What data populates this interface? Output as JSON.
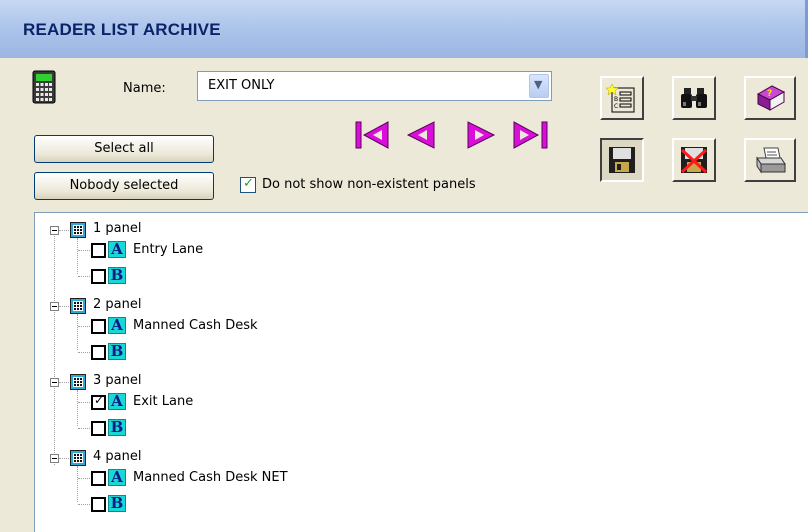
{
  "window": {
    "title": "READER LIST ARCHIVE"
  },
  "form": {
    "name_label": "Name:",
    "name_value": "EXIT ONLY",
    "select_all_label": "Select all",
    "nobody_selected_label": "Nobody selected",
    "hide_nonexistent_label": "Do not show non-existent panels",
    "hide_nonexistent_checked": true
  },
  "navigation": [
    {
      "name": "first-record-icon"
    },
    {
      "name": "previous-record-icon"
    },
    {
      "name": "next-record-icon"
    },
    {
      "name": "last-record-icon"
    }
  ],
  "toolbar": [
    {
      "name": "new-list-icon"
    },
    {
      "name": "find-binoculars-icon"
    },
    {
      "name": "help-book-icon"
    },
    {
      "name": "save-floppy-icon"
    },
    {
      "name": "delete-icon"
    },
    {
      "name": "print-icon"
    }
  ],
  "tree": [
    {
      "label": "1 panel",
      "readers": [
        {
          "letter": "A",
          "label": "Entry Lane",
          "checked": false
        },
        {
          "letter": "B",
          "label": "",
          "checked": false
        }
      ]
    },
    {
      "label": "2 panel",
      "readers": [
        {
          "letter": "A",
          "label": "Manned Cash Desk",
          "checked": false
        },
        {
          "letter": "B",
          "label": "",
          "checked": false
        }
      ]
    },
    {
      "label": "3 panel",
      "readers": [
        {
          "letter": "A",
          "label": "Exit Lane",
          "checked": true
        },
        {
          "letter": "B",
          "label": "",
          "checked": false
        }
      ]
    },
    {
      "label": "4 panel",
      "readers": [
        {
          "letter": "A",
          "label": "Manned Cash Desk NET",
          "checked": false
        },
        {
          "letter": "B",
          "label": "",
          "checked": false
        }
      ]
    }
  ],
  "colors": {
    "nav_arrow": "#d90fd9",
    "reader_letter_bg": "#19d7d7",
    "title_text": "#0a246a"
  }
}
